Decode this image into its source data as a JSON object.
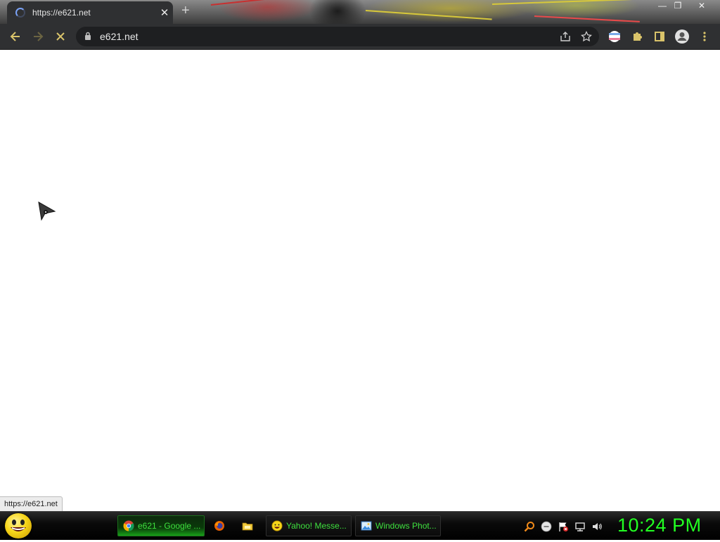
{
  "browser": {
    "tab": {
      "title": "https://e621.net"
    },
    "omnibox": {
      "url": "e621.net"
    },
    "window_controls": {
      "minimize": "—",
      "maximize": "❐",
      "close": "✕"
    },
    "new_tab": "+",
    "tab_close": "✕"
  },
  "page": {
    "status_url": "https://e621.net"
  },
  "taskbar": {
    "buttons": [
      {
        "label": "e621 - Google ...",
        "icon": "chrome-icon",
        "active": true
      },
      {
        "label": "",
        "icon": "firefox-icon"
      },
      {
        "label": "",
        "icon": "folder-icon"
      },
      {
        "label": "Yahoo! Messe...",
        "icon": "yahoo-messenger-icon"
      },
      {
        "label": "Windows Phot...",
        "icon": "windows-photo-viewer-icon"
      }
    ],
    "clock": "10:24 PM"
  },
  "colors": {
    "toolbar_bg": "#2f3032",
    "taskbar_text": "#3ee03e",
    "clock": "#22ff22"
  }
}
